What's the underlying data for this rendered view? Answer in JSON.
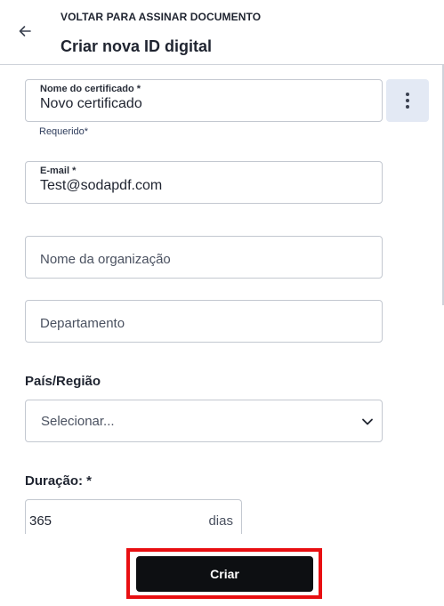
{
  "header": {
    "back_label": "VOLTAR PARA ASSINAR DOCUMENTO",
    "title": "Criar nova ID digital",
    "back_icon": "arrow-left-icon"
  },
  "form": {
    "certificate_name": {
      "label": "Nome do certificado *",
      "value": "Novo certificado",
      "helper": "Requerido*"
    },
    "menu_icon": "more-vertical-icon",
    "email": {
      "label": "E-mail *",
      "value": "Test@sodapdf.com"
    },
    "organization": {
      "placeholder": "Nome da organização"
    },
    "department": {
      "placeholder": "Departamento"
    },
    "country": {
      "section_label": "País/Região",
      "selected": "Selecionar...",
      "icon": "chevron-down-icon"
    },
    "duration": {
      "section_label": "Duração: *",
      "value": "365",
      "unit": "dias"
    }
  },
  "actions": {
    "create_label": "Criar"
  },
  "colors": {
    "highlight": "#e80f12",
    "primary_button": "#0d0f12",
    "menu_button_bg": "#e3e9f4"
  }
}
